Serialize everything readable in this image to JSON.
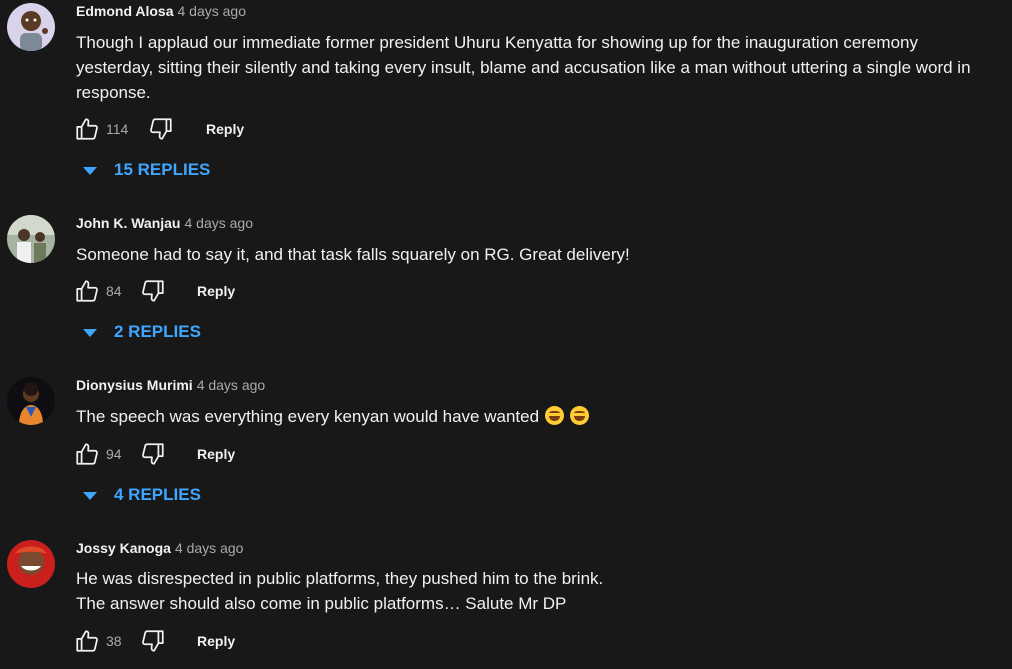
{
  "reply_label": "Reply",
  "comments": [
    {
      "author": "Edmond Alosa",
      "time": "4 days ago",
      "lines": [
        "Though I applaud our immediate former president Uhuru Kenyatta for showing up for the inauguration ceremony",
        "yesterday,  sitting their silently and taking every insult,  blame and accusation like a man without uttering a single word in",
        "response."
      ],
      "likes": "114",
      "replies": "15 REPLIES",
      "avatar_color": "#d9d2ea"
    },
    {
      "author": "John K. Wanjau",
      "time": "4 days ago",
      "lines": [
        "Someone had to say it, and that task falls squarely on RG. Great delivery!"
      ],
      "likes": "84",
      "replies": "2 REPLIES",
      "avatar_color": "#8a9a82"
    },
    {
      "author": "Dionysius Murimi",
      "time": "4 days ago",
      "lines": [
        "The speech was everything every kenyan would have wanted"
      ],
      "emoji": [
        "face-with-tears-of-joy",
        "face-with-tears-of-joy"
      ],
      "likes": "94",
      "replies": "4 REPLIES",
      "avatar_color": "#e8862e"
    },
    {
      "author": "Jossy Kanoga",
      "time": "4 days ago",
      "lines": [
        "He was disrespected in public platforms, they pushed him to the brink.",
        "The answer should also come in public platforms… Salute Mr DP"
      ],
      "likes": "38",
      "avatar_color": "#c9201e"
    }
  ],
  "colors": {
    "background": "#181818",
    "link_blue": "#3ea6ff",
    "secondary_text": "#aaaaaa"
  }
}
